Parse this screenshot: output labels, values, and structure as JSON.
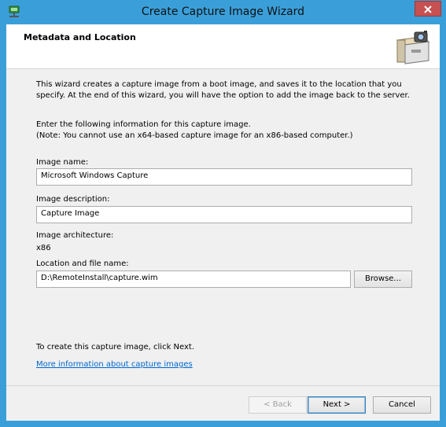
{
  "window": {
    "title": "Create Capture Image Wizard",
    "accent": "#3a9fd9",
    "close_color": "#c75050",
    "app_icon": "network-computer-icon",
    "close_icon": "close-icon"
  },
  "header": {
    "title": "Metadata and Location",
    "icon": "file-cabinet-camera-icon"
  },
  "body": {
    "intro": "This wizard creates a capture image from a boot image, and saves it to the location that you specify. At the end of this wizard, you will have the option to add the image back to the server.",
    "instruction_line1": "Enter the following information for this capture image.",
    "instruction_line2": "(Note: You cannot use an x64-based capture image for an x86-based computer.)"
  },
  "form": {
    "image_name_label": "Image name:",
    "image_name_value": "Microsoft Windows Capture",
    "image_description_label": "Image description:",
    "image_description_value": "Capture Image",
    "image_architecture_label": "Image architecture:",
    "image_architecture_value": "x86",
    "location_label": "Location and file name:",
    "location_value": "D:\\RemoteInstall\\capture.wim",
    "browse_label": "Browse..."
  },
  "footer": {
    "next_hint": "To create this capture image, click Next.",
    "more_info_link": "More information about capture images",
    "back_label": "< Back",
    "next_label": "Next >",
    "cancel_label": "Cancel"
  }
}
